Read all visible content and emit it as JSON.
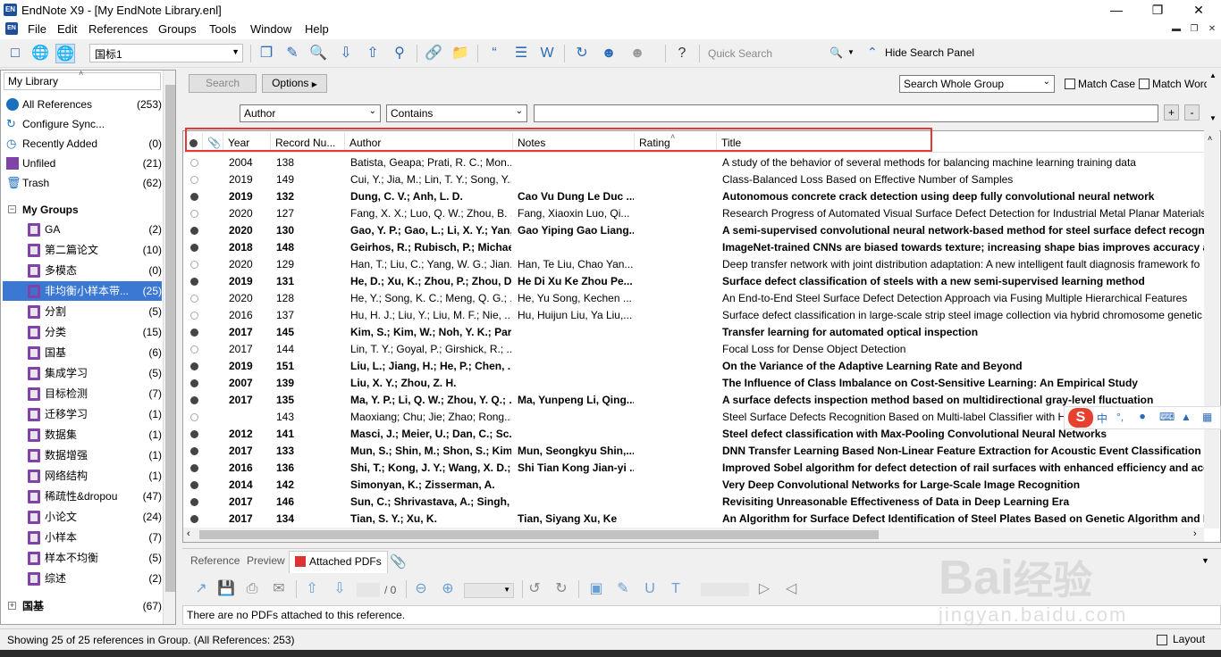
{
  "app": {
    "title": "EndNote X9 - [My EndNote Library.enl]",
    "icon_text": "EN"
  },
  "menu": [
    "File",
    "Edit",
    "References",
    "Groups",
    "Tools",
    "Window",
    "Help"
  ],
  "toolbar": {
    "style": "国标1",
    "quick_search_placeholder": "Quick Search",
    "hide_search_label": "Hide Search Panel"
  },
  "sidebar": {
    "header": "My Library",
    "items": [
      {
        "label": "All References",
        "count": "(253)",
        "icon": "all-references-icon"
      },
      {
        "label": "Configure Sync...",
        "count": "",
        "icon": "sync-icon"
      },
      {
        "label": "Recently Added",
        "count": "(0)",
        "icon": "clock-icon"
      },
      {
        "label": "Unfiled",
        "count": "(21)",
        "icon": "unfiled-icon"
      },
      {
        "label": "Trash",
        "count": "(62)",
        "icon": "trash-icon"
      }
    ],
    "my_groups_label": "My Groups",
    "groups": [
      {
        "label": "GA",
        "count": "(2)"
      },
      {
        "label": "第二篇论文",
        "count": "(10)"
      },
      {
        "label": "多模态",
        "count": "(0)"
      },
      {
        "label": "非均衡小样本带...",
        "count": "(25)",
        "selected": true
      },
      {
        "label": "分割",
        "count": "(5)"
      },
      {
        "label": "分类",
        "count": "(15)"
      },
      {
        "label": "国基",
        "count": "(6)"
      },
      {
        "label": "集成学习",
        "count": "(5)"
      },
      {
        "label": "目标检测",
        "count": "(7)"
      },
      {
        "label": "迁移学习",
        "count": "(1)"
      },
      {
        "label": "数据集",
        "count": "(1)"
      },
      {
        "label": "数据增强",
        "count": "(1)"
      },
      {
        "label": "网络结构",
        "count": "(1)"
      },
      {
        "label": "稀疏性&dropou",
        "count": "(47)"
      },
      {
        "label": "小论文",
        "count": "(24)"
      },
      {
        "label": "小样本",
        "count": "(7)"
      },
      {
        "label": "样本不均衡",
        "count": "(5)"
      },
      {
        "label": "综述",
        "count": "(2)"
      }
    ],
    "bottom_group": {
      "label": "国基",
      "count": "(67)"
    }
  },
  "search": {
    "search_button": "Search",
    "options_button": "Options",
    "scope": "Search Whole Group",
    "match_case": "Match Case",
    "match_words": "Match Words",
    "field": "Author",
    "condition": "Contains",
    "value": ""
  },
  "columns": {
    "year": "Year",
    "record": "Record Nu...",
    "author": "Author",
    "notes": "Notes",
    "rating": "Rating",
    "title": "Title"
  },
  "references": [
    {
      "unread": false,
      "year": "2004",
      "record": "138",
      "author": "Batista, Geapa; Prati, R. C.; Mon...",
      "notes": "",
      "title": "A study of the behavior of several methods for balancing machine learning training data"
    },
    {
      "unread": false,
      "year": "2019",
      "record": "149",
      "author": "Cui, Y.; Jia, M.; Lin, T. Y.; Song, Y...",
      "notes": "",
      "title": "Class-Balanced Loss Based on Effective Number of Samples"
    },
    {
      "unread": true,
      "year": "2019",
      "record": "132",
      "author": "Dung, C. V.; Anh, L. D.",
      "notes": "Cao Vu Dung Le Duc ...",
      "title": "Autonomous concrete crack detection using deep fully convolutional neural network"
    },
    {
      "unread": false,
      "year": "2020",
      "record": "127",
      "author": "Fang, X. X.; Luo, Q. W.; Zhou, B. ...",
      "notes": "Fang, Xiaoxin Luo, Qi...",
      "title": "Research Progress of Automated Visual Surface Defect Detection for Industrial Metal Planar Materials"
    },
    {
      "unread": true,
      "year": "2020",
      "record": "130",
      "author": "Gao, Y. P.; Gao, L.; Li, X. Y.; Yan, ...",
      "notes": "Gao Yiping Gao Liang...",
      "title": "A semi-supervised convolutional neural network-based method for steel surface defect recogniti"
    },
    {
      "unread": true,
      "year": "2018",
      "record": "148",
      "author": "Geirhos, R.; Rubisch, P.; Michae...",
      "notes": "",
      "title": "ImageNet-trained CNNs are biased towards texture; increasing shape bias improves accuracy and"
    },
    {
      "unread": false,
      "year": "2020",
      "record": "129",
      "author": "Han, T.; Liu, C.; Yang, W. G.; Jian...",
      "notes": "Han, Te Liu, Chao Yan...",
      "title": "Deep transfer network with joint distribution adaptation: A new intelligent fault diagnosis framework fo"
    },
    {
      "unread": true,
      "year": "2019",
      "record": "131",
      "author": "He, D.; Xu, K.; Zhou, P.; Zhou, D...",
      "notes": "He Di Xu Ke Zhou Pe...",
      "title": "Surface defect classification of steels with a new semi-supervised learning method"
    },
    {
      "unread": false,
      "year": "2020",
      "record": "128",
      "author": "He, Y.; Song, K. C.; Meng, Q. G.; ...",
      "notes": "He, Yu Song, Kechen ...",
      "title": "An End-to-End Steel Surface Defect Detection Approach via Fusing Multiple Hierarchical Features"
    },
    {
      "unread": false,
      "year": "2016",
      "record": "137",
      "author": "Hu, H. J.; Liu, Y.; Liu, M. F.; Nie, ...",
      "notes": "Hu, Huijun Liu, Ya Liu,...",
      "title": "Surface defect classification in large-scale strip steel image collection via hybrid chromosome genetic a"
    },
    {
      "unread": true,
      "year": "2017",
      "record": "145",
      "author": "Kim, S.; Kim, W.; Noh, Y. K.; Par...",
      "notes": "",
      "title": "Transfer learning for automated optical inspection"
    },
    {
      "unread": false,
      "year": "2017",
      "record": "144",
      "author": "Lin, T. Y.; Goyal, P.; Girshick, R.; ...",
      "notes": "",
      "title": "Focal Loss for Dense Object Detection"
    },
    {
      "unread": true,
      "year": "2019",
      "record": "151",
      "author": "Liu, L.; Jiang, H.; He, P.; Chen, ...",
      "notes": "",
      "title": "On the Variance of the Adaptive Learning Rate and Beyond"
    },
    {
      "unread": true,
      "year": "2007",
      "record": "139",
      "author": "Liu, X. Y.; Zhou, Z. H.",
      "notes": "",
      "title": "The Influence of Class Imbalance on Cost-Sensitive Learning: An Empirical Study"
    },
    {
      "unread": true,
      "year": "2017",
      "record": "135",
      "author": "Ma, Y. P.; Li, Q. W.; Zhou, Y. Q.; ...",
      "notes": "Ma, Yunpeng Li, Qing...",
      "title": "A surface defects inspection method based on multidirectional gray-level fluctuation"
    },
    {
      "unread": false,
      "year": "",
      "record": "143",
      "author": "Maoxiang; Chu; Jie; Zhao; Rong...",
      "notes": "",
      "title": "Steel Surface Defects Recognition Based on Multi-label Classifier with Hy"
    },
    {
      "unread": true,
      "year": "2012",
      "record": "141",
      "author": "Masci, J.; Meier, U.; Dan, C.; Sc...",
      "notes": "",
      "title": "Steel defect classification with Max-Pooling Convolutional Neural Networks"
    },
    {
      "unread": true,
      "year": "2017",
      "record": "133",
      "author": "Mun, S.; Shin, M.; Shon, S.; Kim...",
      "notes": "Mun, Seongkyu Shin,...",
      "title": "DNN Transfer Learning Based Non-Linear Feature Extraction for Acoustic Event Classification"
    },
    {
      "unread": true,
      "year": "2016",
      "record": "136",
      "author": "Shi, T.; Kong, J. Y.; Wang, X. D.; ...",
      "notes": "Shi Tian Kong Jian-yi ...",
      "title": "Improved Sobel algorithm for defect detection of rail surfaces with enhanced efficiency and accu"
    },
    {
      "unread": true,
      "year": "2014",
      "record": "142",
      "author": "Simonyan, K.; Zisserman, A.",
      "notes": "",
      "title": "Very Deep Convolutional Networks for Large-Scale Image Recognition"
    },
    {
      "unread": true,
      "year": "2017",
      "record": "146",
      "author": "Sun, C.; Shrivastava, A.; Singh, ...",
      "notes": "",
      "title": "Revisiting Unreasonable Effectiveness of Data in Deep Learning Era"
    },
    {
      "unread": true,
      "year": "2017",
      "record": "134",
      "author": "Tian, S. Y.; Xu, K.",
      "notes": "Tian, Siyang Xu, Ke",
      "title": "An Algorithm for Surface Defect Identification of Steel Plates Based on Genetic Algorithm and Ex"
    }
  ],
  "pane_tabs": {
    "reference": "Reference",
    "preview": "Preview",
    "attached": "Attached PDFs"
  },
  "pdf": {
    "page_total": "/ 0",
    "message": "There are no PDFs attached to this reference."
  },
  "status": {
    "text": "Showing 25 of 25 references in Group. (All References: 253)",
    "layout_label": "Layout"
  },
  "ime": {
    "chinese": "中"
  },
  "watermark": {
    "brand": "Bai",
    "brand_cn": "经验",
    "url": "jingyan.baidu.com"
  }
}
